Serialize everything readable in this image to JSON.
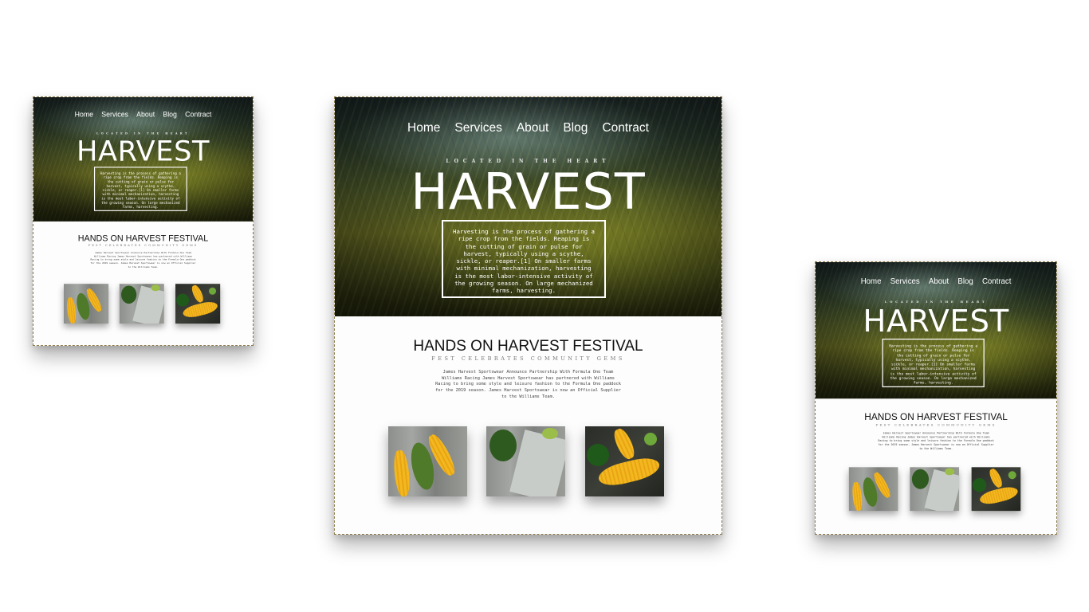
{
  "site": {
    "nav": [
      "Home",
      "Services",
      "About",
      "Blog",
      "Contract"
    ],
    "kicker": "LOCATED IN THE HEART",
    "title": "HARVEST",
    "hero_text": "Harvesting is the process of gathering a ripe crop from the fields. Reaping is the cutting of grain or pulse for harvest, typically using a scythe, sickle, or reaper.[1] On smaller farms with minimal mechanization, harvesting is the most labor-intensive activity of the growing season. On large mechanized farms, harvesting.",
    "festival_title": "HANDS ON HARVEST FESTIVAL",
    "festival_subtitle": "FEST CELEBRATES COMMUNITY GEMS",
    "festival_text": "James Harvest Sportswear Announce Partnership With Formula One Team Williams Racing James Harvest Sportswear has partnered with Williams Racing to bring some style and leisure fashion to the Formula One paddock for the 2019 season. James Harvest Sportswear is now an Official Supplier to the Williams Team.",
    "gallery": [
      "corn-and-zucchini-photo",
      "vegetables-on-board-photo",
      "corn-and-peppers-photo"
    ]
  },
  "colors": {
    "hero_dark": "#1d2a2a",
    "field_green": "#5b5e1f",
    "text_white": "#ffffff",
    "heading_dark": "#111111",
    "frame_border": "#8a7a4a"
  }
}
